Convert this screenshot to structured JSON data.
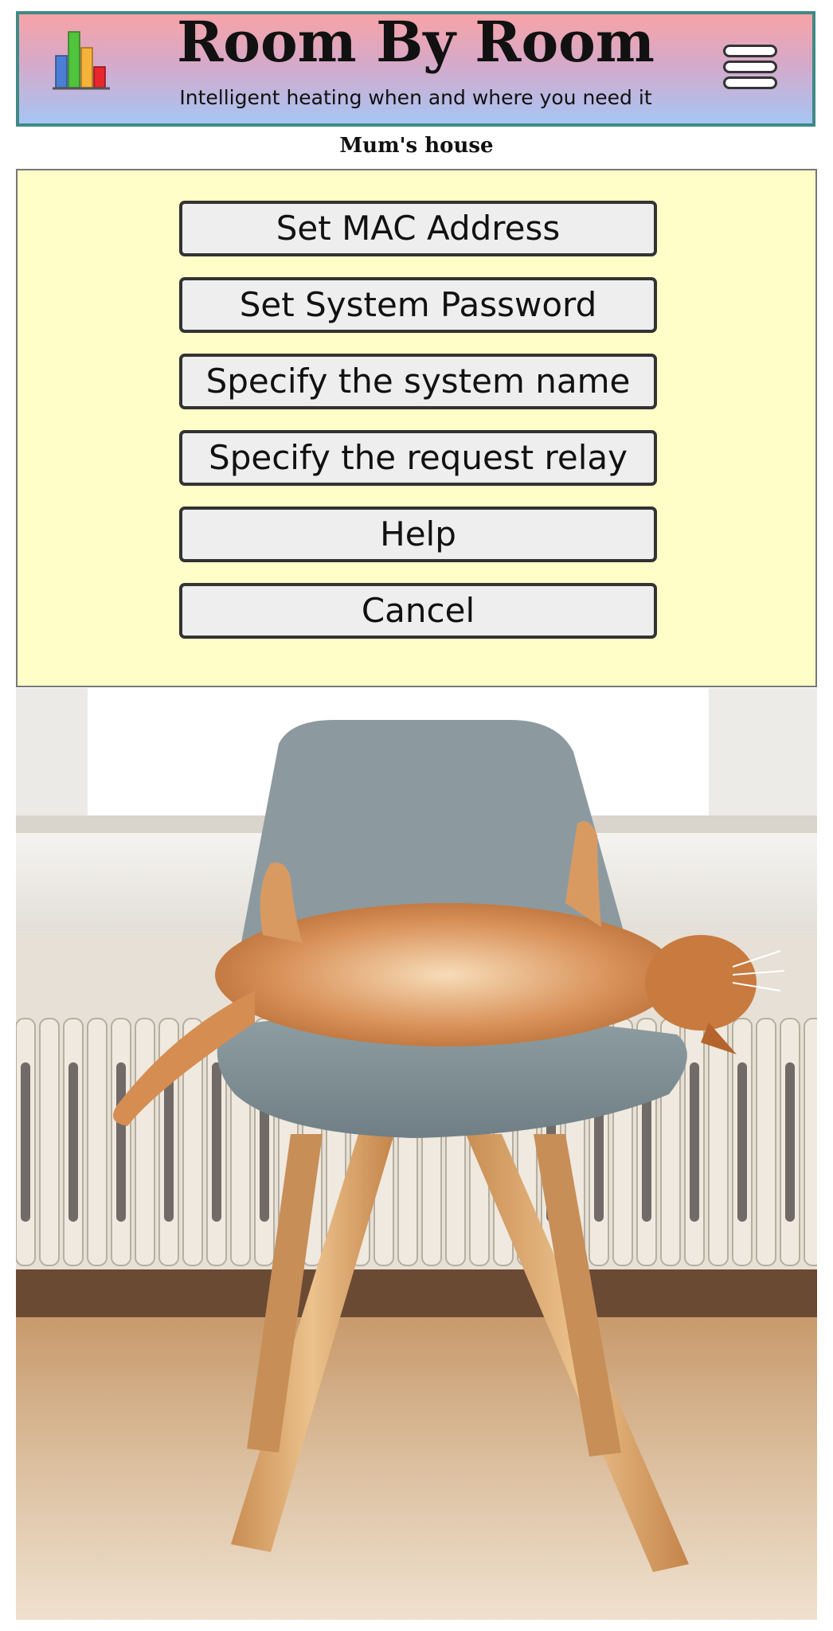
{
  "header": {
    "title": "Room By Room",
    "subtitle": "Intelligent heating when and where you need it",
    "logo_icon": "bar-chart-icon",
    "menu_icon": "hamburger-menu-icon",
    "logo_colors": [
      "#4a7fd4",
      "#4fc43c",
      "#f6b33a",
      "#e8262c"
    ],
    "border_color": "#3e8a85"
  },
  "location": {
    "name": "Mum's house"
  },
  "menu": {
    "items": [
      {
        "label": "Set MAC Address"
      },
      {
        "label": "Set System Password"
      },
      {
        "label": "Specify the system name"
      },
      {
        "label": "Specify the request relay"
      },
      {
        "label": "Help"
      },
      {
        "label": "Cancel"
      }
    ],
    "panel_color": "#fffdc8"
  },
  "photo": {
    "subject": "cat-on-chair-photo"
  }
}
